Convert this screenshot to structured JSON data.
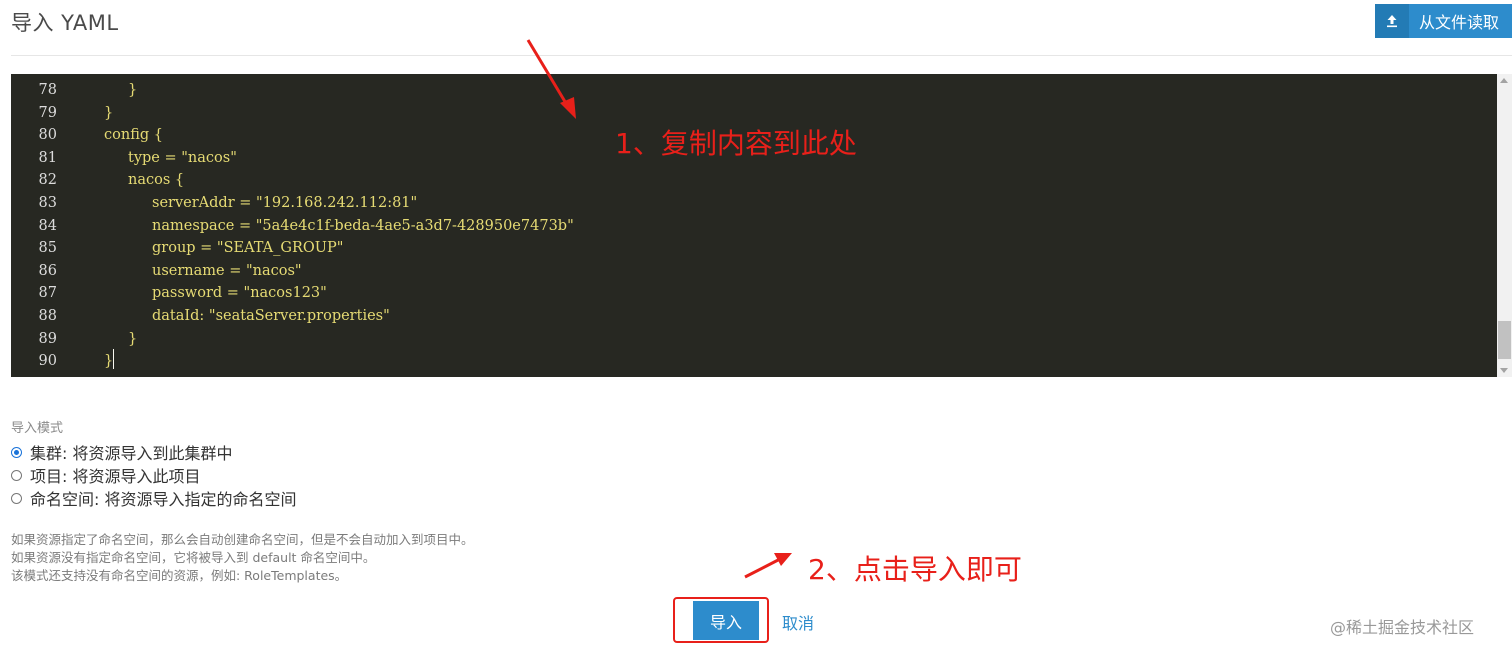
{
  "header": {
    "title": "导入 YAML",
    "upload_label": "从文件读取",
    "upload_icon": "upload-icon"
  },
  "editor": {
    "lines": [
      {
        "num": "78",
        "indent": 2,
        "text": "}"
      },
      {
        "num": "79",
        "indent": 1,
        "text": "}"
      },
      {
        "num": "80",
        "indent": 1,
        "text": "config {"
      },
      {
        "num": "81",
        "indent": 2,
        "text": "type = \"nacos\""
      },
      {
        "num": "82",
        "indent": 2,
        "text": "nacos {"
      },
      {
        "num": "83",
        "indent": 3,
        "text": "serverAddr = \"192.168.242.112:81\""
      },
      {
        "num": "84",
        "indent": 3,
        "text": "namespace = \"5a4e4c1f-beda-4ae5-a3d7-428950e7473b\""
      },
      {
        "num": "85",
        "indent": 3,
        "text": "group = \"SEATA_GROUP\""
      },
      {
        "num": "86",
        "indent": 3,
        "text": "username = \"nacos\""
      },
      {
        "num": "87",
        "indent": 3,
        "text": "password = \"nacos123\""
      },
      {
        "num": "88",
        "indent": 3,
        "text": "dataId: \"seataServer.properties\""
      },
      {
        "num": "89",
        "indent": 2,
        "text": "}"
      },
      {
        "num": "90",
        "indent": 1,
        "text": "}"
      }
    ]
  },
  "mode": {
    "label": "导入模式",
    "options": [
      {
        "label": "集群: 将资源导入到此集群中",
        "checked": true
      },
      {
        "label": "项目: 将资源导入此项目",
        "checked": false
      },
      {
        "label": "命名空间: 将资源导入指定的命名空间",
        "checked": false
      }
    ]
  },
  "notes": [
    "如果资源指定了命名空间，那么会自动创建命名空间，但是不会自动加入到项目中。",
    "如果资源没有指定命名空间，它将被导入到 default 命名空间中。",
    "该模式还支持没有命名空间的资源，例如: RoleTemplates。"
  ],
  "annotations": {
    "step1": "1、复制内容到此处",
    "step2": "2、点击导入即可"
  },
  "footer": {
    "import_label": "导入",
    "cancel_label": "取消"
  },
  "watermark": "@稀土掘金技术社区",
  "colors": {
    "primary": "#2d8ccc",
    "annotation_red": "#e8201a",
    "editor_bg": "#272822",
    "code_string": "#e6db74"
  }
}
